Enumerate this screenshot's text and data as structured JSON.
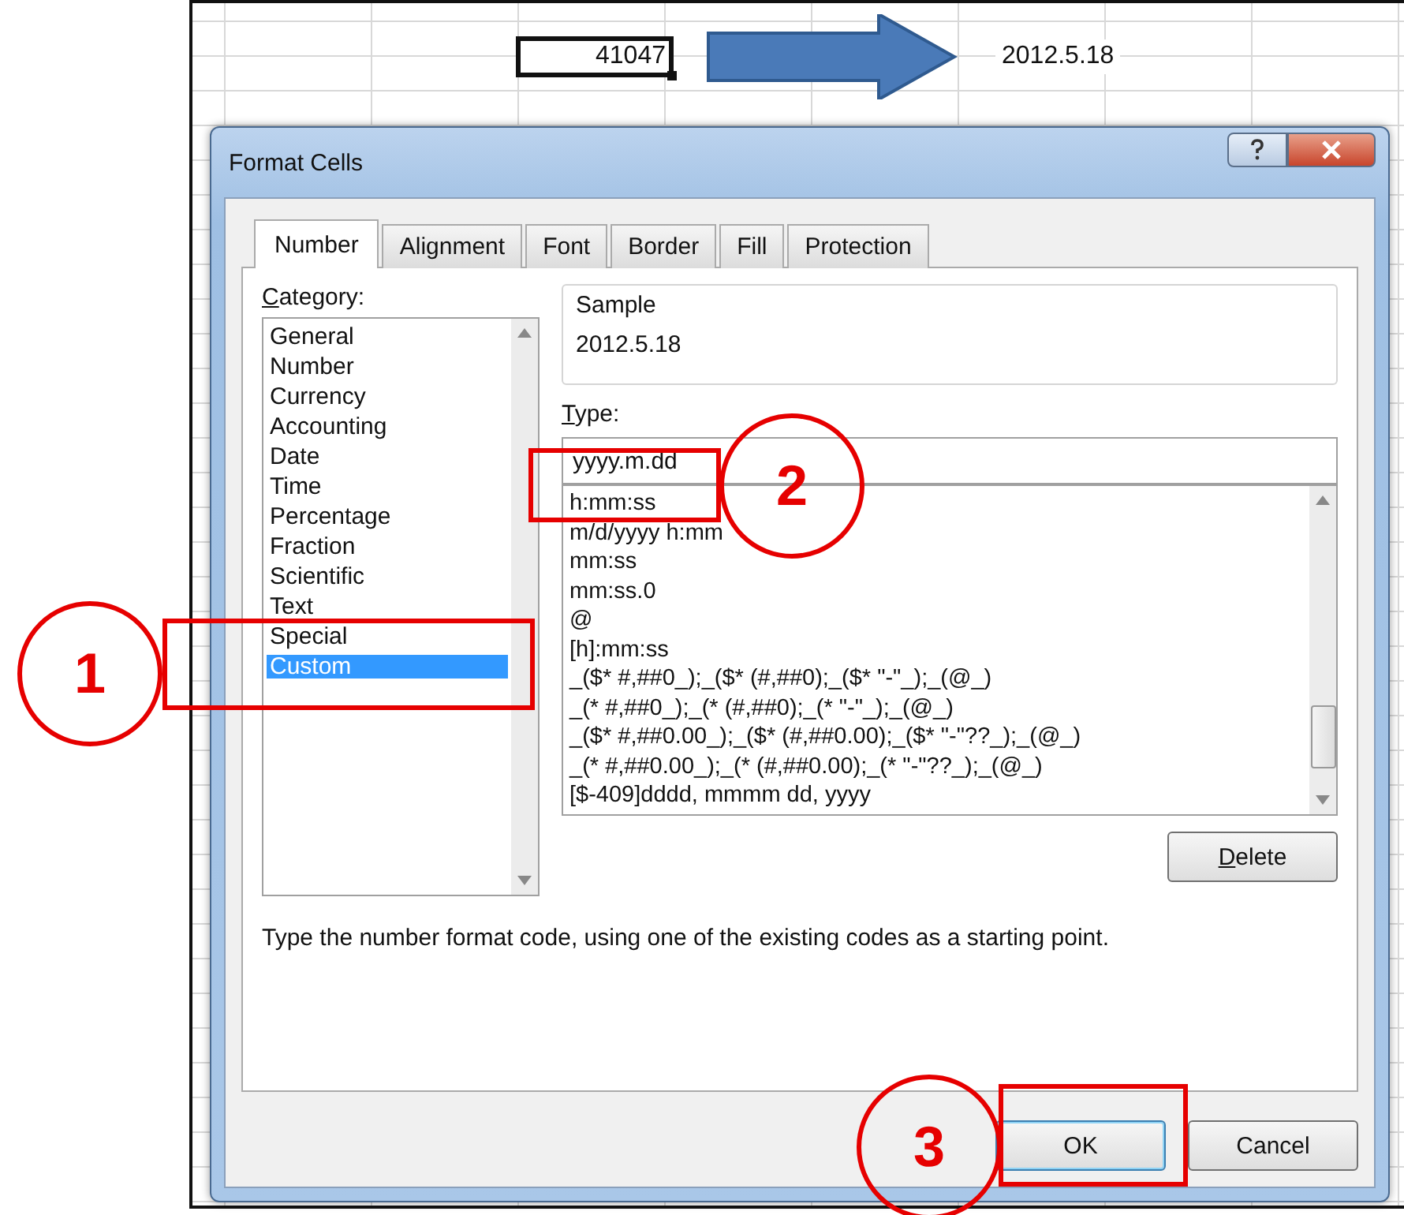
{
  "sheet": {
    "source_value": "41047",
    "result_value": "2012.5.18"
  },
  "dialog": {
    "title": "Format Cells"
  },
  "tabs": [
    {
      "label": "Number",
      "selected": true
    },
    {
      "label": "Alignment",
      "selected": false
    },
    {
      "label": "Font",
      "selected": false
    },
    {
      "label": "Border",
      "selected": false
    },
    {
      "label": "Fill",
      "selected": false
    },
    {
      "label": "Protection",
      "selected": false
    }
  ],
  "category": {
    "label": "Category:",
    "items": [
      {
        "label": "General",
        "selected": false
      },
      {
        "label": "Number",
        "selected": false
      },
      {
        "label": "Currency",
        "selected": false
      },
      {
        "label": "Accounting",
        "selected": false
      },
      {
        "label": "Date",
        "selected": false
      },
      {
        "label": "Time",
        "selected": false
      },
      {
        "label": "Percentage",
        "selected": false
      },
      {
        "label": "Fraction",
        "selected": false
      },
      {
        "label": "Scientific",
        "selected": false
      },
      {
        "label": "Text",
        "selected": false
      },
      {
        "label": "Special",
        "selected": false
      },
      {
        "label": "Custom",
        "selected": true
      }
    ]
  },
  "sample": {
    "label": "Sample",
    "value": "2012.5.18"
  },
  "type": {
    "label": "Type:",
    "value": "yyyy.m.dd",
    "items": [
      "h:mm:ss",
      "m/d/yyyy h:mm",
      "mm:ss",
      "mm:ss.0",
      "@",
      "[h]:mm:ss",
      "_($* #,##0_);_($* (#,##0);_($* \"-\"_);_(@_)",
      "_(* #,##0_);_(* (#,##0);_(* \"-\"_);_(@_)",
      "_($* #,##0.00_);_($* (#,##0.00);_($* \"-\"??_);_(@_)",
      "_(* #,##0.00_);_(* (#,##0.00);_(* \"-\"??_);_(@_)",
      "[$-409]dddd, mmmm dd, yyyy"
    ]
  },
  "delete_button": "Delete",
  "description": "Type the number format code, using one of the existing codes as a starting point.",
  "ok_button": "OK",
  "cancel_button": "Cancel",
  "annotations": [
    {
      "label": "1"
    },
    {
      "label": "2"
    },
    {
      "label": "3"
    }
  ]
}
